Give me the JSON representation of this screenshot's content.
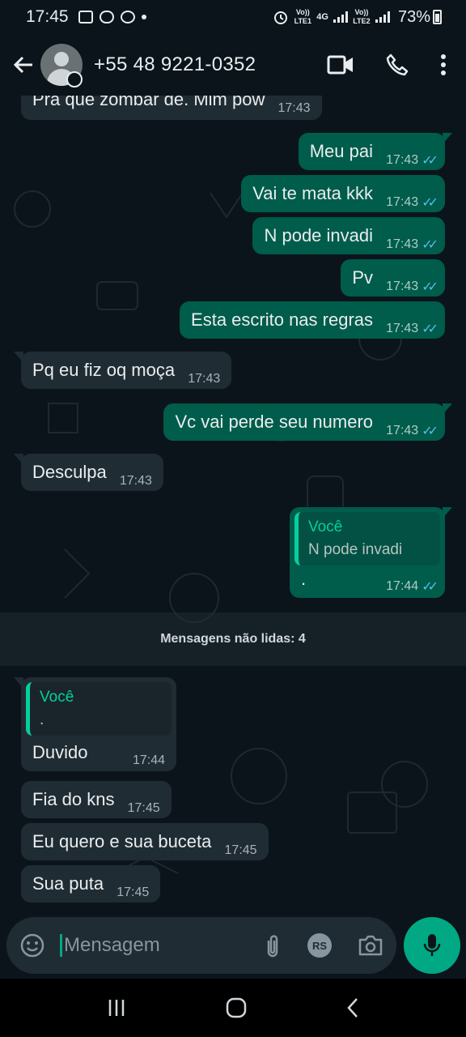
{
  "status_bar": {
    "time": "17:45",
    "sim1_label": "Vo)) LTE1",
    "net_label": "4G",
    "sim2_label": "Vo)) LTE2",
    "battery": "73%"
  },
  "header": {
    "contact": "+55 48 9221-0352"
  },
  "messages": [
    {
      "dir": "in",
      "text": "Pra que zombar  de.  Mim pow",
      "time": "17:43"
    },
    {
      "dir": "out",
      "text": "Meu pai",
      "time": "17:43"
    },
    {
      "dir": "out",
      "text": "Vai te mata kkk",
      "time": "17:43"
    },
    {
      "dir": "out",
      "text": "N pode invadi",
      "time": "17:43"
    },
    {
      "dir": "out",
      "text": "Pv",
      "time": "17:43"
    },
    {
      "dir": "out",
      "text": "Esta escrito nas regras",
      "time": "17:43"
    },
    {
      "dir": "in",
      "text": "Pq eu fiz oq moça",
      "time": "17:43"
    },
    {
      "dir": "out",
      "text": "Vc vai perde seu numero",
      "time": "17:43"
    },
    {
      "dir": "in",
      "text": "Desculpa",
      "time": "17:43"
    },
    {
      "dir": "out",
      "quote_name": "Você",
      "quote_text": "N pode invadi",
      "text": ".",
      "time": "17:44"
    },
    {
      "dir": "in",
      "quote_name": "Você",
      "quote_text": ".",
      "text": "Duvido",
      "time": "17:44"
    },
    {
      "dir": "in",
      "text": "Fia do kns",
      "time": "17:45"
    },
    {
      "dir": "in",
      "text": "Eu quero e sua buceta",
      "time": "17:45"
    },
    {
      "dir": "in",
      "text": "Sua puta",
      "time": "17:45"
    }
  ],
  "unread_divider": "Mensagens não lidas: 4",
  "composer": {
    "placeholder": "Mensagem",
    "rs_badge": "RS"
  },
  "colors": {
    "background": "#0b141a",
    "incoming_bubble": "#202c33",
    "outgoing_bubble": "#005c4b",
    "accent": "#00a884",
    "read_ticks": "#53bdeb"
  }
}
